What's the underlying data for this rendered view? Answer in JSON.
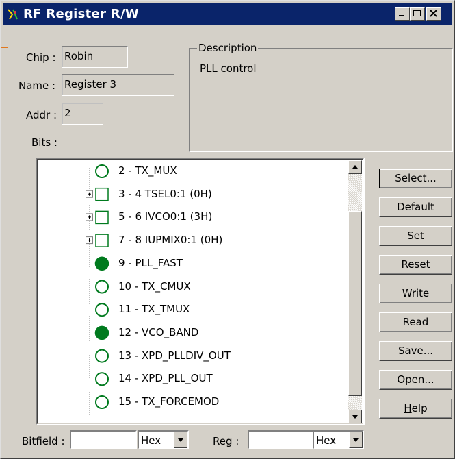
{
  "window": {
    "title": "RF Register R/W",
    "caption_buttons": [
      "minimize-icon",
      "maximize-icon",
      "close-icon"
    ],
    "accent_color": "#0a246a",
    "face_color": "#d4d0c8"
  },
  "fields": {
    "chip_label": "Chip :",
    "chip_value": "Robin",
    "name_label": "Name :",
    "name_value": "Register 3",
    "addr_label": "Addr :",
    "addr_value": "2",
    "bits_label": "Bits :"
  },
  "description": {
    "legend": "Description",
    "text": "PLL control"
  },
  "tree": {
    "items": [
      {
        "label": "2 - TX_MUX",
        "icon": "circle-empty",
        "expandable": false
      },
      {
        "label": "3 - 4 TSEL0:1 (0H)",
        "icon": "square-empty",
        "expandable": true
      },
      {
        "label": "5 - 6 IVCO0:1 (3H)",
        "icon": "square-empty",
        "expandable": true
      },
      {
        "label": "7 - 8 IUPMIX0:1 (0H)",
        "icon": "square-empty",
        "expandable": true
      },
      {
        "label": "9 - PLL_FAST",
        "icon": "circle-filled",
        "expandable": false
      },
      {
        "label": "10 - TX_CMUX",
        "icon": "circle-empty",
        "expandable": false
      },
      {
        "label": "11 - TX_TMUX",
        "icon": "circle-empty",
        "expandable": false
      },
      {
        "label": "12 - VCO_BAND",
        "icon": "circle-filled",
        "expandable": false
      },
      {
        "label": "13 - XPD_PLLDIV_OUT",
        "icon": "circle-empty",
        "expandable": false
      },
      {
        "label": "14 - XPD_PLL_OUT",
        "icon": "circle-empty",
        "expandable": false
      },
      {
        "label": "15 - TX_FORCEMOD",
        "icon": "circle-empty",
        "expandable": false
      }
    ],
    "bit_color": "#007a1e"
  },
  "buttons": {
    "select": "Select...",
    "default": "Default",
    "set": "Set",
    "reset": "Reset",
    "write": "Write",
    "read": "Read",
    "save": "Save...",
    "open": "Open...",
    "help_prefix": "H",
    "help_rest": "elp"
  },
  "bottom": {
    "bitfield_label": "Bitfield :",
    "bitfield_value": "",
    "bitfield_format": "Hex",
    "reg_label": "Reg :",
    "reg_value": "",
    "reg_format": "Hex"
  }
}
